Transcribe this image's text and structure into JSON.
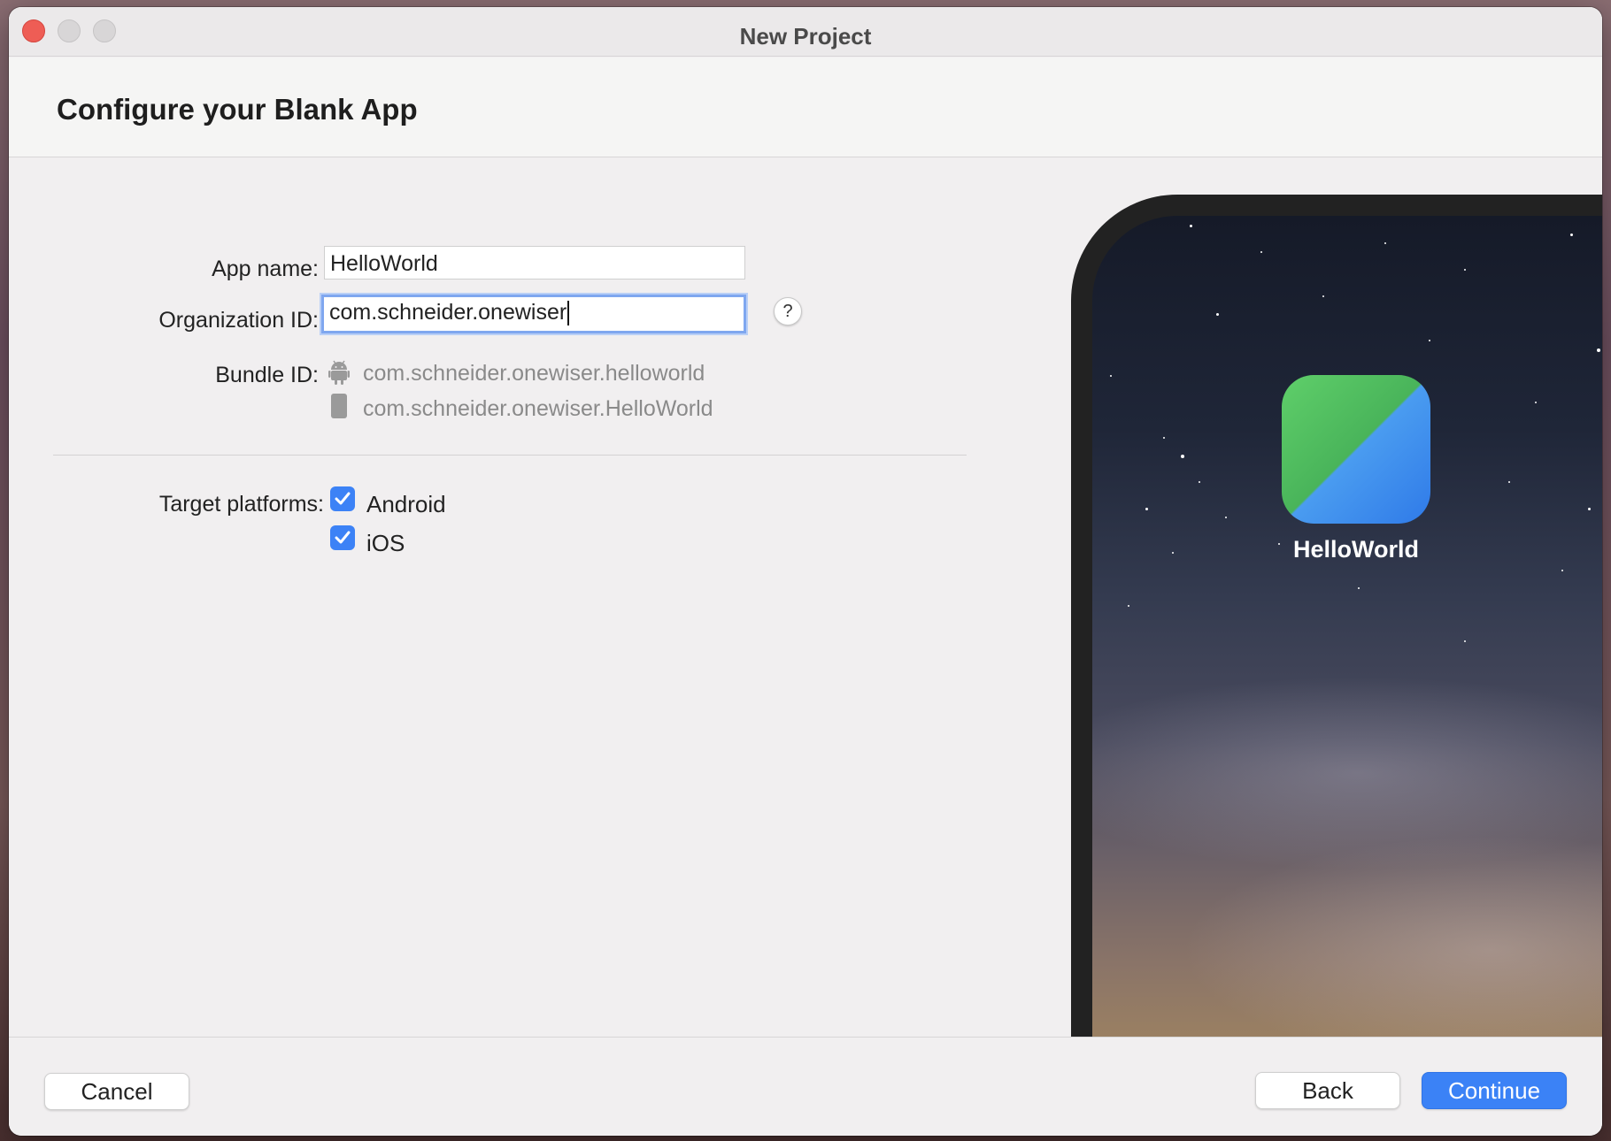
{
  "window": {
    "title": "New Project"
  },
  "header": {
    "title": "Configure your Blank App"
  },
  "form": {
    "app_name_label": "App name:",
    "app_name_value": "HelloWorld",
    "org_id_label": "Organization ID:",
    "org_id_value": "com.schneider.onewiser",
    "help_label": "?",
    "bundle_id_label": "Bundle ID:",
    "bundle_android": "com.schneider.onewiser.helloworld",
    "bundle_ios": "com.schneider.onewiser.HelloWorld",
    "target_platforms_label": "Target platforms:",
    "platforms": [
      {
        "label": "Android",
        "checked": true
      },
      {
        "label": "iOS",
        "checked": true
      }
    ]
  },
  "preview": {
    "app_name": "HelloWorld",
    "icon": "app-icon-green-blue-diagonal"
  },
  "footer": {
    "cancel_label": "Cancel",
    "back_label": "Back",
    "continue_label": "Continue"
  },
  "colors": {
    "accent": "#3b82f6",
    "close_button": "#ee5d55",
    "checkbox": "#3c82f6"
  }
}
